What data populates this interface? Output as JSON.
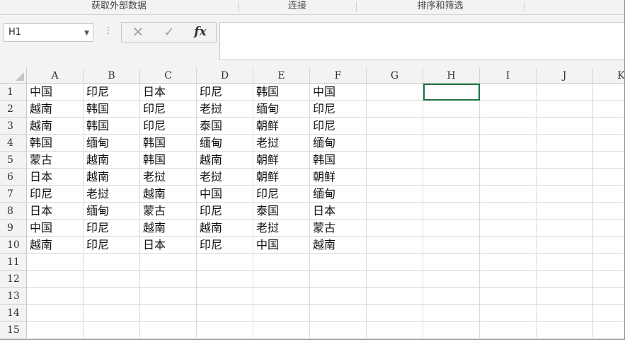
{
  "ribbon": {
    "groups": [
      "获取外部数据",
      "连接",
      "排序和筛选"
    ]
  },
  "formula_bar": {
    "name_box": "H1",
    "name_box_dropdown_icon": "chevron-down-icon",
    "more_icon": "⋮",
    "cancel_glyph": "✕",
    "enter_glyph": "✓",
    "fx_label": "fx",
    "formula": ""
  },
  "sheet": {
    "selected_cell": "H1",
    "columns": [
      "A",
      "B",
      "C",
      "D",
      "E",
      "F",
      "G",
      "H",
      "I",
      "J",
      "K"
    ],
    "row_numbers": [
      "1",
      "2",
      "3",
      "4",
      "5",
      "6",
      "7",
      "8",
      "9",
      "10",
      "11",
      "12",
      "13",
      "14",
      "15"
    ],
    "rows": [
      [
        "中国",
        "印尼",
        "日本",
        "印尼",
        "韩国",
        "中国"
      ],
      [
        "越南",
        "韩国",
        "印尼",
        "老挝",
        "缅甸",
        "印尼"
      ],
      [
        "越南",
        "韩国",
        "印尼",
        "泰国",
        "朝鲜",
        "印尼"
      ],
      [
        "韩国",
        "缅甸",
        "韩国",
        "缅甸",
        "老挝",
        "缅甸"
      ],
      [
        "蒙古",
        "越南",
        "韩国",
        "越南",
        "朝鲜",
        "韩国"
      ],
      [
        "日本",
        "越南",
        "老挝",
        "老挝",
        "朝鲜",
        "朝鲜"
      ],
      [
        "印尼",
        "老挝",
        "越南",
        "中国",
        "印尼",
        "缅甸"
      ],
      [
        "日本",
        "缅甸",
        "蒙古",
        "印尼",
        "泰国",
        "日本"
      ],
      [
        "中国",
        "印尼",
        "越南",
        "越南",
        "老挝",
        "蒙古"
      ],
      [
        "越南",
        "印尼",
        "日本",
        "印尼",
        "中国",
        "越南"
      ]
    ]
  },
  "colors": {
    "accent": "#217346",
    "header_bg": "#f3f3f3",
    "gridline": "#dadada"
  }
}
